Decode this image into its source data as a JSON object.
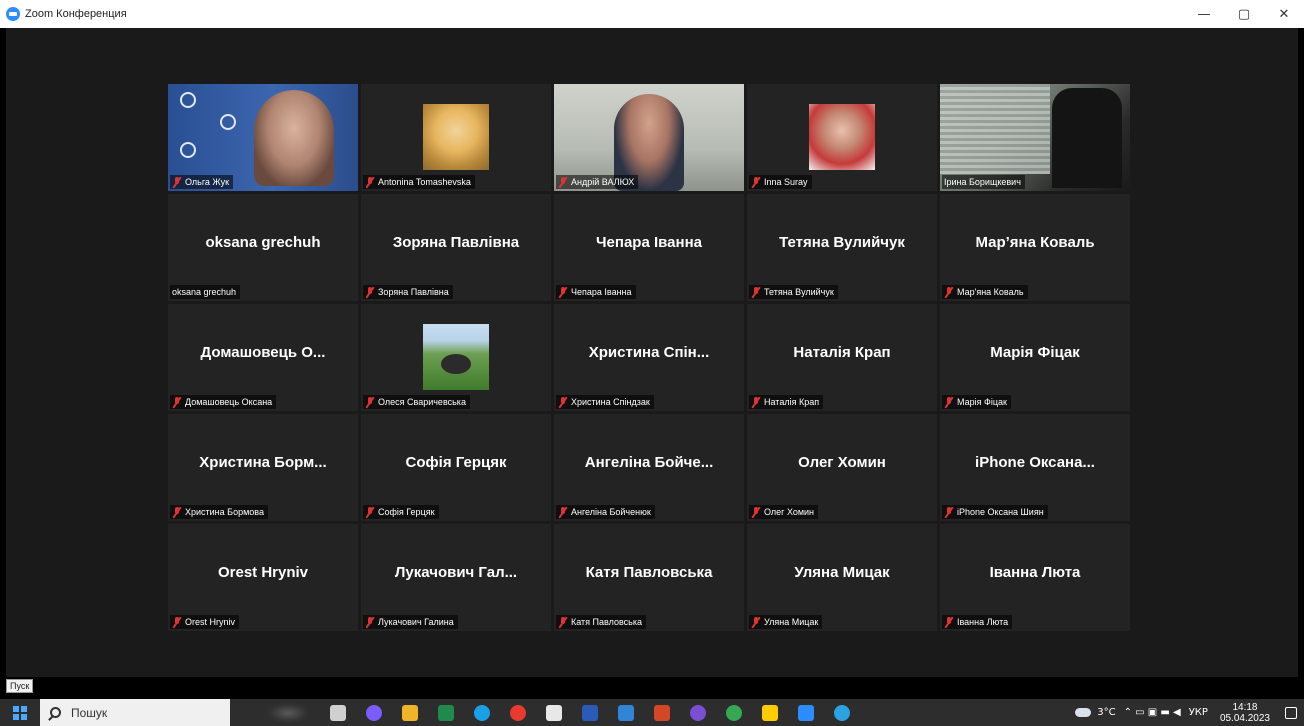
{
  "window": {
    "title": "Zoom Конференция",
    "controls": [
      "—",
      "▢",
      "✕"
    ]
  },
  "participants": [
    {
      "name": "Ольга Жук",
      "display": "",
      "media": "video",
      "video_kind": "olga",
      "muted": true,
      "active": false
    },
    {
      "name": "Antonina Tomashevska",
      "display": "",
      "media": "photo",
      "photo_kind": "antonina",
      "muted": true,
      "active": false
    },
    {
      "name": "Андрій ВАЛЮХ",
      "display": "",
      "media": "video",
      "video_kind": "andriy",
      "muted": true,
      "active": false
    },
    {
      "name": "Inna Suray",
      "display": "",
      "media": "photo",
      "photo_kind": "inna",
      "muted": true,
      "active": false
    },
    {
      "name": "Ірина Борищкевич",
      "display": "",
      "media": "video",
      "video_kind": "iryna",
      "muted": false,
      "active": true
    },
    {
      "name": "oksana grechuh",
      "display": "oksana grechuh",
      "media": "text",
      "muted": false,
      "active": false
    },
    {
      "name": "Зоряна Павлівна",
      "display": "Зоряна Павлівна",
      "media": "text",
      "muted": true,
      "active": false
    },
    {
      "name": "Чепара Іванна",
      "display": "Чепара Іванна",
      "media": "text",
      "muted": true,
      "active": false
    },
    {
      "name": "Тетяна Вулийчук",
      "display": "Тетяна Вулийчук",
      "media": "text",
      "muted": true,
      "active": false
    },
    {
      "name": "Мар'яна Коваль",
      "display": "Мар’яна Коваль",
      "media": "text",
      "muted": true,
      "active": false
    },
    {
      "name": "Домашовець Оксана",
      "display": "Домашовець О...",
      "media": "text",
      "muted": true,
      "active": false
    },
    {
      "name": "Олеся Сваричевська",
      "display": "",
      "media": "photo",
      "photo_kind": "olesya",
      "muted": true,
      "active": false
    },
    {
      "name": "Христина Спіндзак",
      "display": "Христина Спін...",
      "media": "text",
      "muted": true,
      "active": false
    },
    {
      "name": "Наталія Крап",
      "display": "Наталія Крап",
      "media": "text",
      "muted": true,
      "active": false
    },
    {
      "name": "Марія Фіцак",
      "display": "Марія Фіцак",
      "media": "text",
      "muted": true,
      "active": false
    },
    {
      "name": "Христина Бормова",
      "display": "Христина Борм...",
      "media": "text",
      "muted": true,
      "active": false
    },
    {
      "name": "Софія Герцяк",
      "display": "Софія Герцяк",
      "media": "text",
      "muted": true,
      "active": false
    },
    {
      "name": "Ангеліна Бойченюк",
      "display": "Ангеліна Бойче...",
      "media": "text",
      "muted": true,
      "active": false
    },
    {
      "name": "Олег Хомин",
      "display": "Олег Хомин",
      "media": "text",
      "muted": true,
      "active": false
    },
    {
      "name": "iPhone Оксана Шиян",
      "display": "iPhone Оксана...",
      "media": "text",
      "muted": true,
      "active": false
    },
    {
      "name": "Orest Hryniv",
      "display": "Orest Hryniv",
      "media": "text",
      "muted": true,
      "active": false
    },
    {
      "name": "Лукачович Галина",
      "display": "Лукачович Гал...",
      "media": "text",
      "muted": true,
      "active": false
    },
    {
      "name": "Катя Павловська",
      "display": "Катя Павловська",
      "media": "text",
      "muted": true,
      "active": false
    },
    {
      "name": "Уляна Мицак",
      "display": "Уляна Мицак",
      "media": "text",
      "muted": true,
      "active": false
    },
    {
      "name": "Іванна Люта",
      "display": "Іванна Люта",
      "media": "text",
      "muted": true,
      "active": false
    }
  ],
  "taskbar": {
    "start_tooltip": "Пуск",
    "search_placeholder": "Пошук",
    "apps": [
      {
        "name": "task-view-icon",
        "color": "#d0d0d0"
      },
      {
        "name": "alice-icon",
        "color": "#7b5cff"
      },
      {
        "name": "file-explorer-icon",
        "color": "#f0b429"
      },
      {
        "name": "excel-icon",
        "color": "#1f8a4c"
      },
      {
        "name": "edge-icon",
        "color": "#1aa0e8"
      },
      {
        "name": "yandex-icon",
        "color": "#e63b2e"
      },
      {
        "name": "calculator-icon",
        "color": "#e8e8e8"
      },
      {
        "name": "word-icon",
        "color": "#2b5bb8"
      },
      {
        "name": "mail-icon",
        "color": "#2f86d6"
      },
      {
        "name": "powerpoint-icon",
        "color": "#d24726"
      },
      {
        "name": "viber-icon",
        "color": "#7a4fd1"
      },
      {
        "name": "chrome-icon",
        "color": "#34a853"
      },
      {
        "name": "yandex-browser-icon",
        "color": "#ffcc00"
      },
      {
        "name": "zoom-icon",
        "color": "#2d8cff",
        "active": true
      },
      {
        "name": "telegram-icon",
        "color": "#2aa3e0"
      }
    ],
    "tray": {
      "temperature": "3°C",
      "language": "УКР",
      "time": "14:18",
      "date": "05.04.2023",
      "notification_count": "1"
    }
  }
}
